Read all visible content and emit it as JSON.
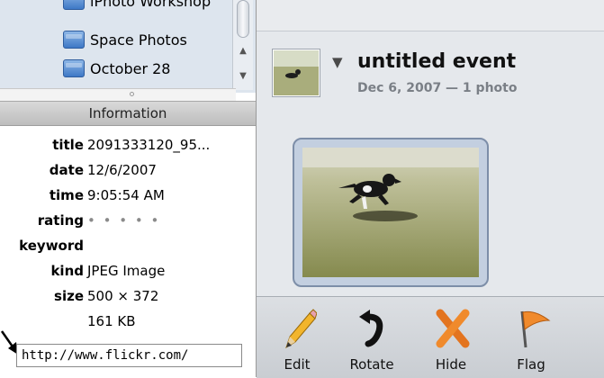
{
  "source_list": {
    "items": [
      {
        "label": "iPhoto Workshop"
      },
      {
        "label": "Space Photos"
      },
      {
        "label": "October 28"
      }
    ]
  },
  "info": {
    "header": "Information",
    "rows": [
      {
        "label": "title",
        "value": "2091333120_95..."
      },
      {
        "label": "date",
        "value": "12/6/2007"
      },
      {
        "label": "time",
        "value": "9:05:54 AM"
      },
      {
        "label": "rating",
        "value": "• • • • •"
      },
      {
        "label": "keyword",
        "value": ""
      },
      {
        "label": "kind",
        "value": "JPEG Image"
      },
      {
        "label": "size",
        "value": "500 × 372"
      },
      {
        "label": "",
        "value": "161 KB"
      }
    ],
    "url_value": "http://www.flickr.com/"
  },
  "event": {
    "title": "untitled event",
    "subtitle": "Dec 6, 2007 — 1 photo"
  },
  "toolbar": {
    "edit": "Edit",
    "rotate": "Rotate",
    "hide": "Hide",
    "flag": "Flag"
  }
}
